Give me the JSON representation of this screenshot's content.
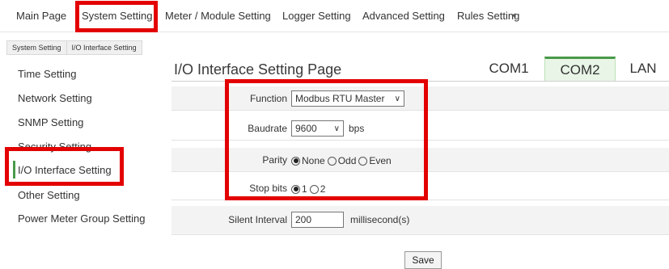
{
  "topnav": {
    "items": [
      "Main Page",
      "System Setting",
      "Meter / Module Setting",
      "Logger Setting",
      "Advanced Setting",
      "Rules Setting"
    ],
    "arrow": "◂"
  },
  "breadcrumb": [
    "System Setting",
    "I/O Interface Setting"
  ],
  "sidebar": {
    "items": [
      "Time Setting",
      "Network Setting",
      "SNMP Setting",
      "Security Setting",
      "I/O Interface Setting",
      "Other Setting",
      "Power Meter Group Setting"
    ],
    "active_index": 4,
    "active_color": "#4a9a4a"
  },
  "page": {
    "title": "I/O Interface Setting Page",
    "tabs": [
      "COM1",
      "COM2",
      "LAN"
    ],
    "active_tab": "COM2"
  },
  "form": {
    "function": {
      "label": "Function",
      "value": "Modbus RTU Master"
    },
    "baudrate": {
      "label": "Baudrate",
      "value": "9600",
      "unit": "bps"
    },
    "parity": {
      "label": "Parity",
      "options": [
        "None",
        "Odd",
        "Even"
      ],
      "selected": "None"
    },
    "stop_bits": {
      "label": "Stop bits",
      "options": [
        "1",
        "2"
      ],
      "selected": "1"
    },
    "silent_interval": {
      "label": "Silent Interval",
      "value": "200",
      "unit": "millisecond(s)"
    }
  },
  "actions": {
    "save_label": "Save"
  },
  "highlight_color": "#e30000"
}
